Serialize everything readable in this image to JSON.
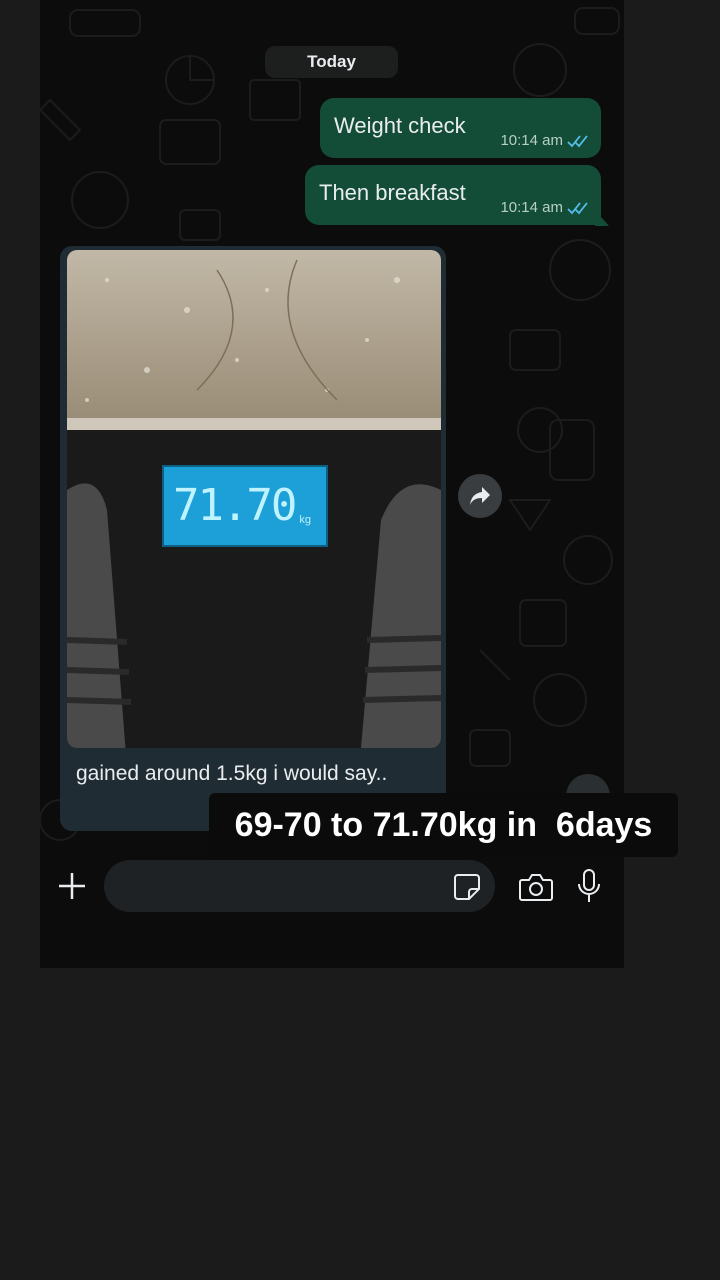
{
  "chat": {
    "date_label": "Today",
    "messages": [
      {
        "text": "Weight check",
        "time": "10:14 am",
        "status": "read"
      },
      {
        "text": "Then breakfast",
        "time": "10:14 am",
        "status": "read"
      }
    ],
    "incoming": {
      "caption": "gained around 1.5kg i would say..",
      "photo": {
        "scale_display": "71.70",
        "scale_unit": "kg"
      }
    }
  },
  "composer": {
    "placeholder": ""
  },
  "overlay_text": "69-70 to 71.70kg in  6days",
  "icons": {
    "forward": "forward-arrow-icon",
    "plus": "plus-icon",
    "sticker": "sticker-icon",
    "camera": "camera-icon",
    "mic": "microphone-icon",
    "read": "double-check-icon"
  },
  "colors": {
    "outgoing_bubble": "#144d37",
    "read_ticks": "#53bdeb",
    "lcd_digits": "#bff3ff",
    "lcd_background": "#1d9fd8"
  }
}
